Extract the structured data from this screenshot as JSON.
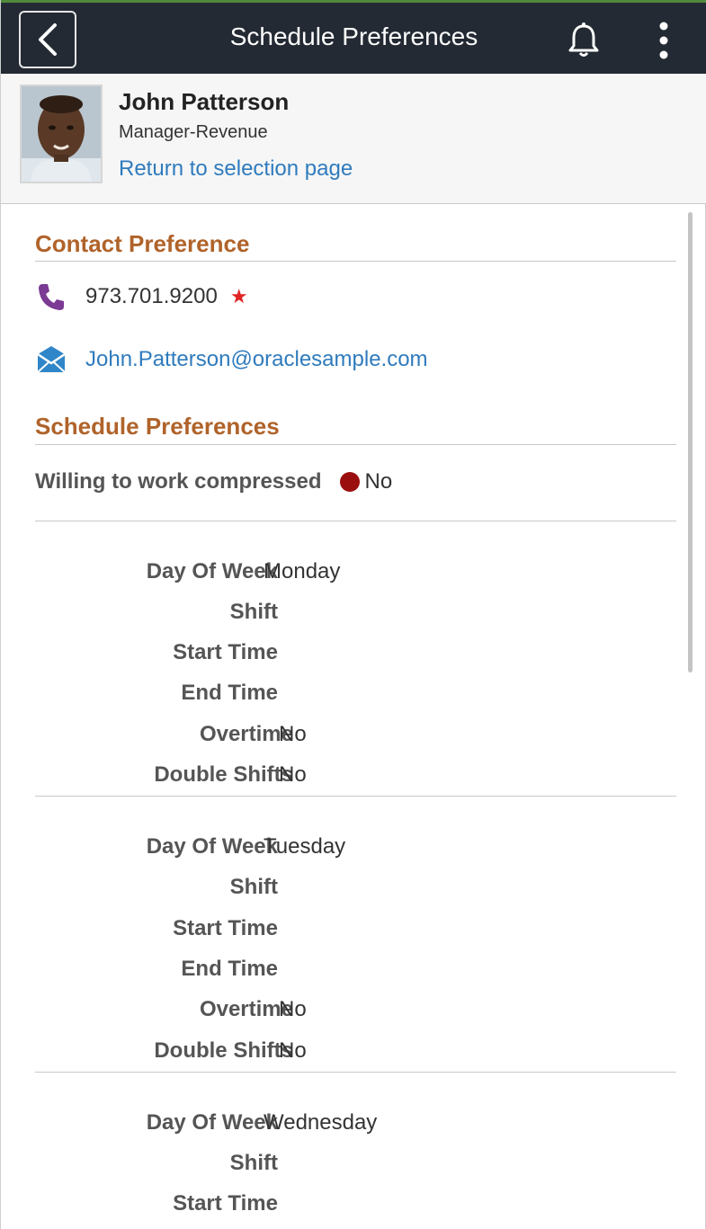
{
  "header": {
    "title": "Schedule Preferences"
  },
  "person": {
    "name": "John Patterson",
    "job_title": "Manager-Revenue",
    "return_link": "Return to selection page"
  },
  "contact": {
    "section_title": "Contact Preference",
    "phone": "973.701.9200",
    "phone_preferred_mark": "★",
    "email": "John.Patterson@oraclesample.com"
  },
  "schedule": {
    "section_title": "Schedule Preferences",
    "compressed_label": "Willing to work compressed",
    "compressed_value": "No",
    "compressed_indicator_color": "#9b0e0e",
    "labels": {
      "day": "Day Of Week",
      "shift": "Shift",
      "start": "Start Time",
      "end": "End Time",
      "overtime": "Overtime",
      "double": "Double Shifts"
    },
    "days": [
      {
        "day": "Monday",
        "shift": "",
        "start": "",
        "end": "",
        "overtime": "No",
        "double": "No"
      },
      {
        "day": "Tuesday",
        "shift": "",
        "start": "",
        "end": "",
        "overtime": "No",
        "double": "No"
      },
      {
        "day": "Wednesday",
        "shift": "",
        "start": ""
      }
    ]
  },
  "colors": {
    "accent_orange": "#b0632a",
    "link_blue": "#2f7bbd",
    "topbar": "#232a33"
  }
}
